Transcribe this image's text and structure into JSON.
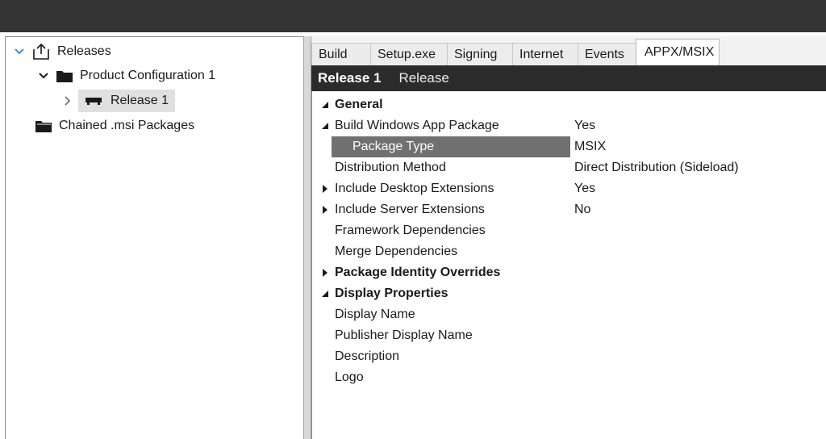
{
  "tree": {
    "releases_label": "Releases",
    "product_config_label": "Product Configuration 1",
    "release_label": "Release 1",
    "chained_label": "Chained .msi Packages"
  },
  "tabs": [
    "Build",
    "Setup.exe",
    "Signing",
    "Internet",
    "Events",
    "APPX/MSIX"
  ],
  "active_tab": "APPX/MSIX",
  "header": {
    "title": "Release 1",
    "subtitle": "Release"
  },
  "properties": [
    {
      "name": "General",
      "value": "",
      "bold": true,
      "expander": "expanded"
    },
    {
      "name": "Build Windows App Package",
      "value": "Yes",
      "bold": false,
      "expander": "expanded"
    },
    {
      "name": "Package Type",
      "value": "MSIX",
      "bold": false,
      "expander": "none",
      "selected": true
    },
    {
      "name": "Distribution Method",
      "value": "Direct Distribution (Sideload)",
      "bold": false,
      "expander": "none"
    },
    {
      "name": "Include Desktop Extensions",
      "value": "Yes",
      "bold": false,
      "expander": "collapsed"
    },
    {
      "name": "Include Server Extensions",
      "value": "No",
      "bold": false,
      "expander": "collapsed"
    },
    {
      "name": "Framework Dependencies",
      "value": "",
      "bold": false,
      "expander": "none"
    },
    {
      "name": "Merge Dependencies",
      "value": "",
      "bold": false,
      "expander": "none"
    },
    {
      "name": "Package Identity Overrides",
      "value": "",
      "bold": true,
      "expander": "collapsed"
    },
    {
      "name": "Display Properties",
      "value": "",
      "bold": true,
      "expander": "expanded"
    },
    {
      "name": "Display Name",
      "value": "",
      "bold": false,
      "expander": "none"
    },
    {
      "name": "Publisher Display Name",
      "value": "",
      "bold": false,
      "expander": "none"
    },
    {
      "name": "Description",
      "value": "",
      "bold": false,
      "expander": "none"
    },
    {
      "name": "Logo",
      "value": "",
      "bold": false,
      "expander": "none"
    }
  ],
  "colors": {
    "topbar": "#333333",
    "header_bar": "#2b2b2b",
    "selected_property": "#707070",
    "tree_expand_accent": "#3a8fd6"
  }
}
